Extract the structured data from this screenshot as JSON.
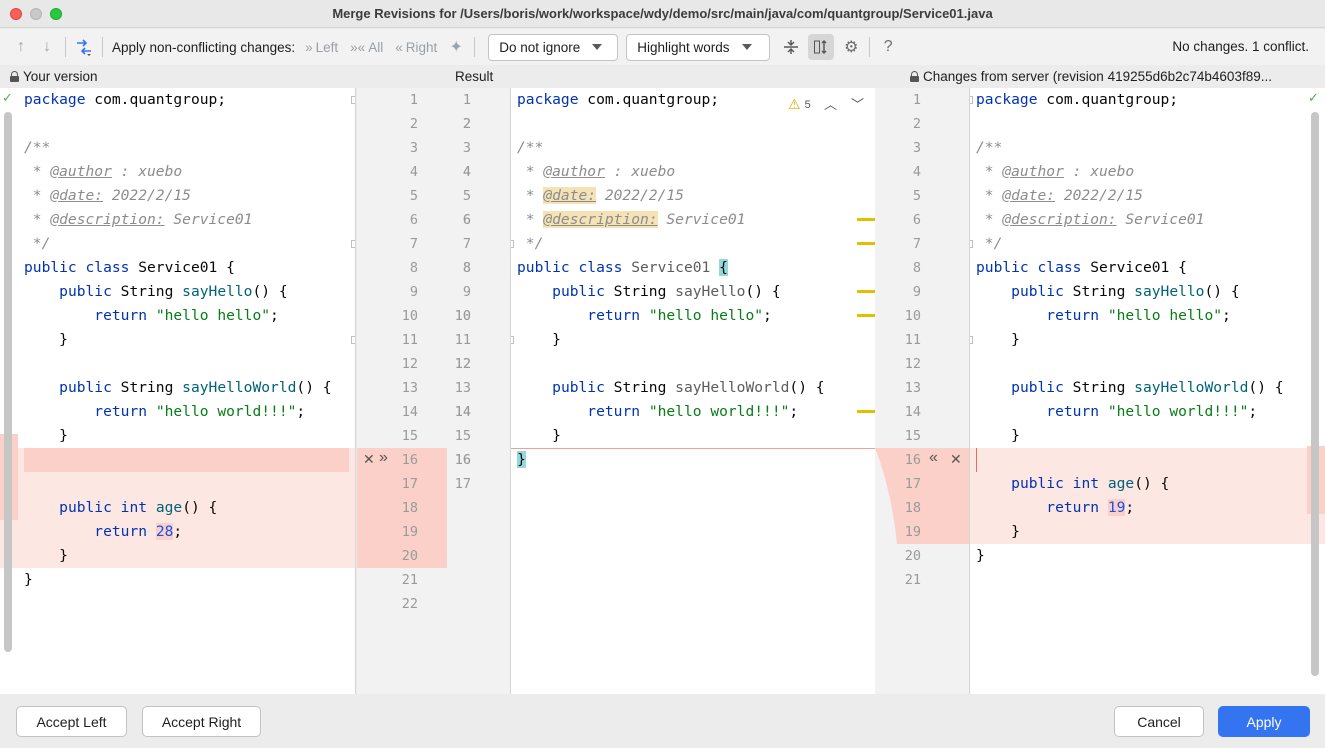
{
  "window": {
    "title": "Merge Revisions for /Users/boris/work/workspace/wdy/demo/src/main/java/com/quantgroup/Service01.java"
  },
  "toolbar": {
    "apply_label": "Apply non-conflicting changes:",
    "left_label": "Left",
    "all_label": "All",
    "right_label": "Right",
    "ignore_dropdown": "Do not ignore",
    "highlight_dropdown": "Highlight words",
    "status": "No changes. 1 conflict."
  },
  "headers": {
    "left": "Your version",
    "center": "Result",
    "right": "Changes from server (revision 419255d6b2c74b4603f89..."
  },
  "result_warnings": "5",
  "left_code": [
    "package com.quantgroup;",
    "",
    "/**",
    " * @author : xuebo",
    " * @date: 2022/2/15",
    " * @description: Service01",
    " */",
    "public class Service01 {",
    "    public String sayHello() {",
    "        return \"hello hello\";",
    "    }",
    "",
    "    public String sayHelloWorld() {",
    "        return \"hello world!!!\";",
    "    }",
    "",
    "",
    "    public int age() {",
    "        return 28;",
    "    }",
    "}",
    ""
  ],
  "center_code": [
    "package com.quantgroup;",
    "",
    "/**",
    " * @author : xuebo",
    " * @date: 2022/2/15",
    " * @description: Service01",
    " */",
    "public class Service01 {",
    "    public String sayHello() {",
    "        return \"hello hello\";",
    "    }",
    "",
    "    public String sayHelloWorld() {",
    "        return \"hello world!!!\";",
    "    }",
    "}",
    ""
  ],
  "right_code": [
    "package com.quantgroup;",
    "",
    "/**",
    " * @author : xuebo",
    " * @date: 2022/2/15",
    " * @description: Service01",
    " */",
    "public class Service01 {",
    "    public String sayHello() {",
    "        return \"hello hello\";",
    "    }",
    "",
    "    public String sayHelloWorld() {",
    "        return \"hello world!!!\";",
    "    }",
    "",
    "    public int age() {",
    "        return 19;",
    "    }",
    "}",
    ""
  ],
  "buttons": {
    "accept_left": "Accept Left",
    "accept_right": "Accept Right",
    "cancel": "Cancel",
    "apply": "Apply"
  },
  "colors": {
    "conflict": "#fde7e3",
    "accent": "#3574f0",
    "modified": "#e0c000"
  }
}
